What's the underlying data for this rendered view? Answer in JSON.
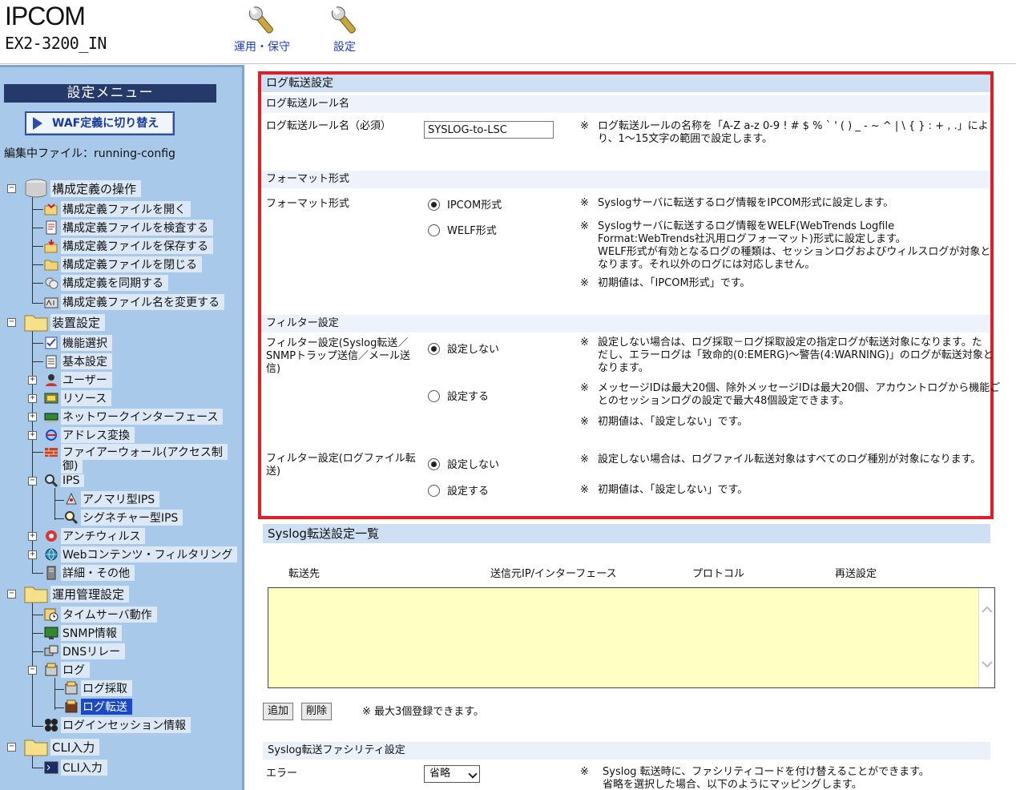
{
  "header": {
    "product": "IPCOM",
    "model": "EX2-3200_IN",
    "tools": [
      {
        "label": "運用・保守"
      },
      {
        "label": "設定"
      }
    ]
  },
  "sidebar": {
    "menu_title": "設定メニュー",
    "waf_button": "WAF定義に切り替え",
    "edit_file": "編集中ファイル：running-config",
    "groups": [
      {
        "label": "構成定義の操作",
        "items": [
          "構成定義ファイルを開く",
          "構成定義ファイルを検査する",
          "構成定義ファイルを保存する",
          "構成定義ファイルを閉じる",
          "構成定義を同期する",
          "構成定義ファイル名を変更する"
        ]
      },
      {
        "label": "装置設定",
        "items": [
          "機能選択",
          "基本設定",
          "ユーザー",
          "リソース",
          "ネットワークインターフェース",
          "アドレス変換",
          "ファイアーウォール(アクセス制",
          "御)",
          "IPS",
          "アノマリ型IPS",
          "シグネチャー型IPS",
          "アンチウィルス",
          "Webコンテンツ・フィルタリング",
          "詳細・その他"
        ]
      },
      {
        "label": "運用管理設定",
        "items": [
          "タイムサーバ動作",
          "SNMP情報",
          "DNSリレー",
          "ログ",
          "ログ採取",
          "ログ転送",
          "ログインセッション情報"
        ]
      },
      {
        "label": "CLI入力",
        "items": [
          "CLI入力"
        ]
      }
    ]
  },
  "main": {
    "log_transfer": {
      "title": "ログ転送設定",
      "rule_section": "ログ転送ルール名",
      "rule_label": "ログ転送ルール名（必須）",
      "rule_value": "SYSLOG-to-LSC",
      "rule_note_1": "ログ転送ルールの名称を「A-Z a-z 0-9 ! # $ % ` ' ( ) _ - ~ ^ | \\ { } : + , .」によ",
      "rule_note_2": "り、1～15文字の範囲で設定します。",
      "format_section": "フォーマット形式",
      "format_label": "フォーマット形式",
      "format_opt_ipcom": "IPCOM形式",
      "format_opt_welf": "WELF形式",
      "format_note_ipcom": "Syslogサーバに転送するログ情報をIPCOM形式に設定します。",
      "format_note_welf_1": "Syslogサーバに転送するログ情報をWELF(WebTrends Logfile",
      "format_note_welf_2": "Format:WebTrends社汎用ログフォーマット)形式に設定します。",
      "format_note_welf_3": "WELF形式が有効となるログの種類は、セッションログおよびウィルスログが対象と",
      "format_note_welf_4": "なります。それ以外のログには対応しません。",
      "format_note_default": "初期値は、「IPCOM形式」です。",
      "filter_section": "フィルター設定",
      "filter1_label_1": "フィルター設定(Syslog転送／",
      "filter1_label_2": "SNMPトラップ送信／メール送",
      "filter1_label_3": "信)",
      "opt_none": "設定しない",
      "opt_set": "設定する",
      "filter1_note_a1": "設定しない場合は、ログ採取－ログ採取設定の指定ログが転送対象になります。た",
      "filter1_note_a2": "だし、エラーログは「致命的(0:EMERG)～警告(4:WARNING)」のログが転送対象と",
      "filter1_note_a3": "なります。",
      "filter1_note_b1": "メッセージIDは最大20個、除外メッセージIDは最大20個、アカウントログから機能ご",
      "filter1_note_b2": "とのセッションログの設定で最大48個設定できます。",
      "filter1_note_c": "初期値は、「設定しない」です。",
      "filter2_label_1": "フィルター設定(ログファイル転",
      "filter2_label_2": "送)",
      "filter2_note_a": "設定しない場合は、ログファイル転送対象はすべてのログ種別が対象になります。",
      "filter2_note_b": "初期値は、「設定しない」です。",
      "mark": "※"
    },
    "syslog_list": {
      "title": "Syslog転送設定一覧",
      "columns": [
        "転送先",
        "送信元IP/インターフェース",
        "プロトコル",
        "再送設定"
      ],
      "add": "追加",
      "delete": "削除",
      "note": "※ 最大3個登録できます。"
    },
    "facility": {
      "title": "Syslog転送ファシリティ設定",
      "error_label": "エラー",
      "error_value": "省略",
      "note_1": "Syslog 転送時に、ファシリティコードを付け替えることができます。",
      "note_2": "省略を選択した場合、以下のようにマッピングします。"
    }
  }
}
